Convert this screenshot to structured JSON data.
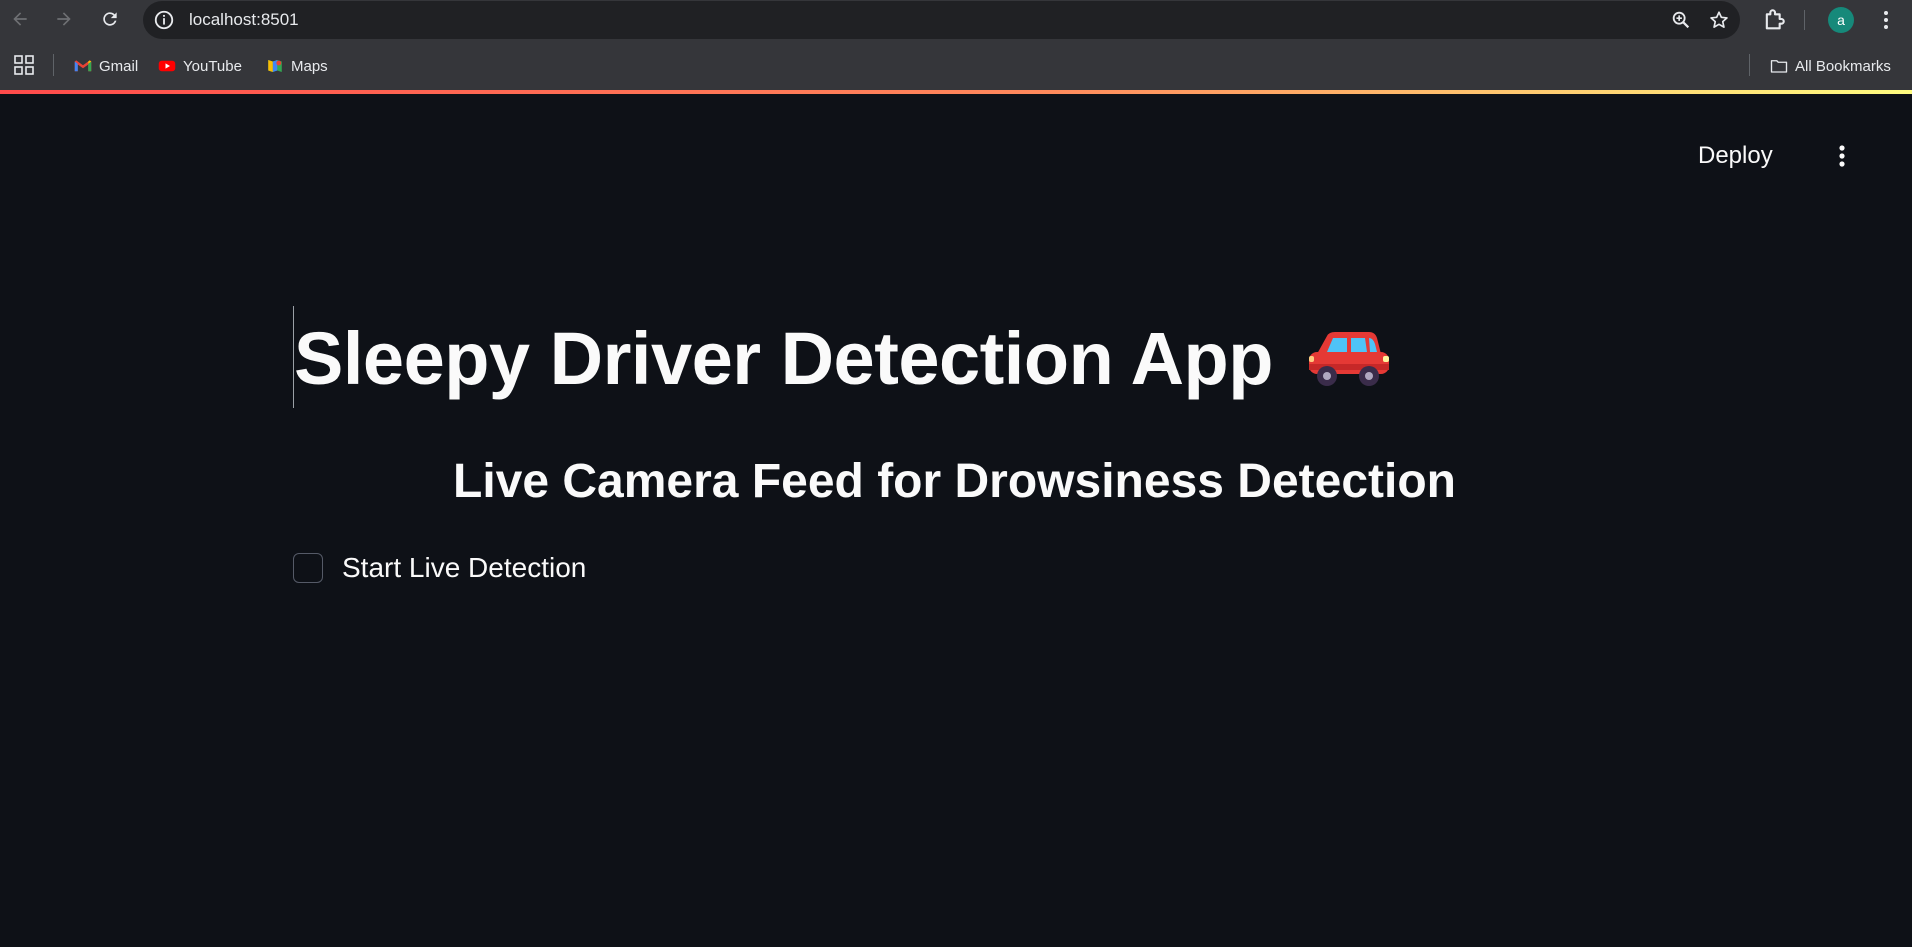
{
  "browser": {
    "url": "localhost:8501",
    "avatar_letter": "a"
  },
  "bookmarks": {
    "items": [
      {
        "label": "Gmail",
        "icon": "gmail-icon"
      },
      {
        "label": "YouTube",
        "icon": "youtube-icon"
      },
      {
        "label": "Maps",
        "icon": "maps-icon"
      }
    ],
    "all_label": "All Bookmarks"
  },
  "app": {
    "deploy_label": "Deploy",
    "title": "Sleepy Driver Detection App",
    "title_emoji": "car-icon",
    "subheading": "Live Camera Feed for Drowsiness Detection",
    "checkbox_label": "Start Live Detection",
    "checkbox_checked": false
  },
  "colors": {
    "background": "#0e1117",
    "text": "#fafafa",
    "accent": "#ff4b4b"
  }
}
